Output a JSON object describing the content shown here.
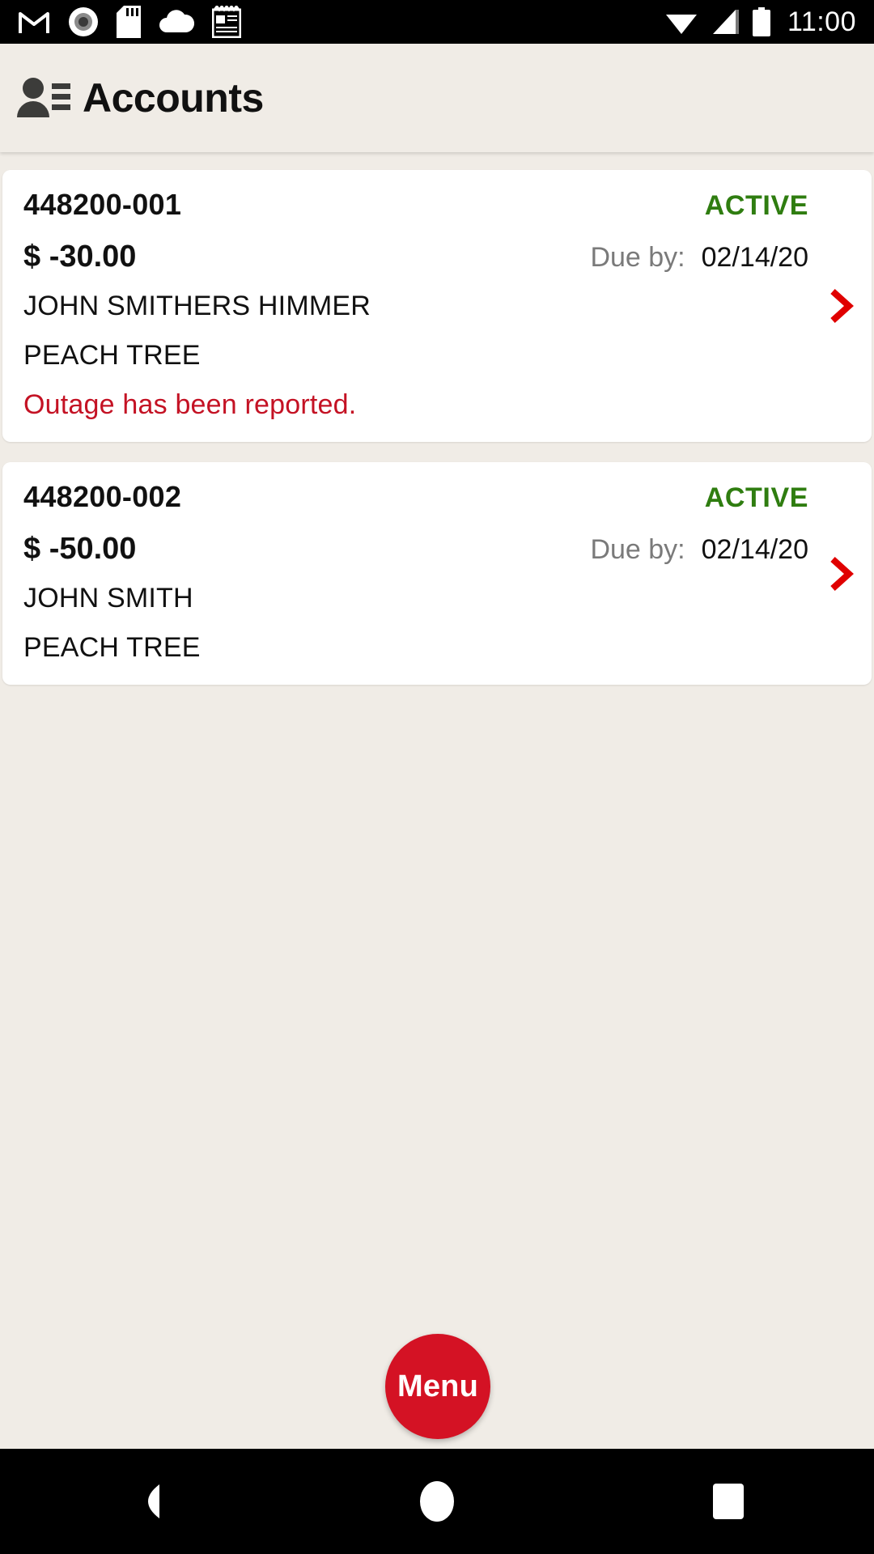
{
  "status_bar": {
    "time": "11:00",
    "left_icons": [
      "gmail-icon",
      "record-icon",
      "sd-card-icon",
      "cloud-icon",
      "notepad-icon"
    ],
    "right_icons": [
      "wifi-icon",
      "cell-signal-icon",
      "battery-icon"
    ],
    "background": "#000000"
  },
  "header": {
    "title": "Accounts",
    "icon": "contacts-icon",
    "background": "#f0ece6"
  },
  "colors": {
    "page_background": "#f0ece6",
    "card_background": "#ffffff",
    "active_green": "#2f7d10",
    "alert_red": "#c41224",
    "chevron_red": "#e00000",
    "fab_red": "#d41224",
    "muted_gray": "#7a7a7a"
  },
  "accounts": [
    {
      "account_number": "448200-001",
      "status": "ACTIVE",
      "currency_symbol": "$",
      "amount": "$ -30.00",
      "due_label": "Due by:",
      "due_date": "02/14/20",
      "customer_name": "JOHN SMITHERS HIMMER",
      "address": "PEACH TREE",
      "alert": "Outage has been reported.",
      "chevron": "chevron-right-icon"
    },
    {
      "account_number": "448200-002",
      "status": "ACTIVE",
      "currency_symbol": "$",
      "amount": "$ -50.00",
      "due_label": "Due by:",
      "due_date": "02/14/20",
      "customer_name": "JOHN SMITH",
      "address": "PEACH TREE",
      "alert": "",
      "chevron": "chevron-right-icon"
    }
  ],
  "fab": {
    "label": "Menu"
  },
  "nav_bar": {
    "back": "back-triangle-icon",
    "home": "home-circle-icon",
    "recents": "recents-square-icon"
  }
}
